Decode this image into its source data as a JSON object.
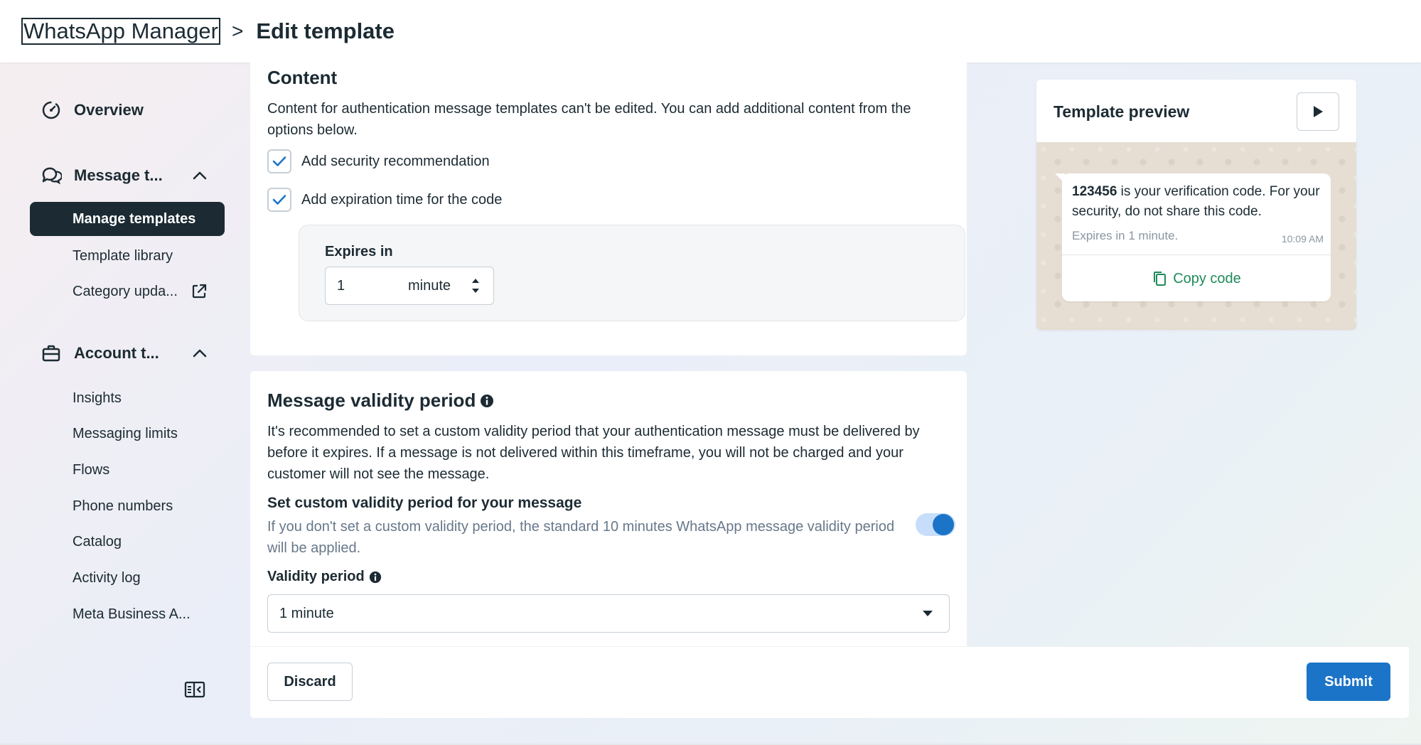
{
  "header": {
    "root": "WhatsApp Manager",
    "separator": ">",
    "current": "Edit template"
  },
  "sidebar": {
    "overview": "Overview",
    "message_templates": {
      "label": "Message t...",
      "expanded": true
    },
    "template_items": [
      "Manage templates",
      "Template library",
      "Category upda..."
    ],
    "account_tools": {
      "label": "Account t...",
      "expanded": true
    },
    "account_items": [
      "Insights",
      "Messaging limits",
      "Flows",
      "Phone numbers",
      "Catalog",
      "Activity log",
      "Meta Business A..."
    ]
  },
  "content": {
    "title": "Content",
    "description": "Content for authentication message templates can't be edited. You can add additional content from the options below.",
    "checkbox_security": {
      "label": "Add security recommendation",
      "checked": true
    },
    "checkbox_expiration": {
      "label": "Add expiration time for the code",
      "checked": true
    },
    "expires_label": "Expires in",
    "expires_value": "1",
    "expires_unit": "minute"
  },
  "validity": {
    "title": "Message validity period",
    "description": "It's recommended to set a custom validity period that your authentication message must be delivered by before it expires. If a message is not delivered within this timeframe, you will not be charged and your customer will not see the message.",
    "toggle_title": "Set custom validity period for your message",
    "toggle_desc": "If you don't set a custom validity period, the standard 10 minutes WhatsApp message validity period will be applied.",
    "toggle_on": true,
    "field_label": "Validity period",
    "selected": "1 minute"
  },
  "footer": {
    "discard": "Discard",
    "submit": "Submit"
  },
  "preview": {
    "title": "Template preview",
    "code": "123456",
    "message_rest": " is your verification code. For your security, do not share this code.",
    "footer": "Expires in 1 minute.",
    "time": "10:09 AM",
    "copy_button": "Copy code"
  },
  "colors": {
    "primary": "#1b74c8",
    "active_nav": "#1c2b33",
    "copy_green": "#1f8a5a"
  }
}
